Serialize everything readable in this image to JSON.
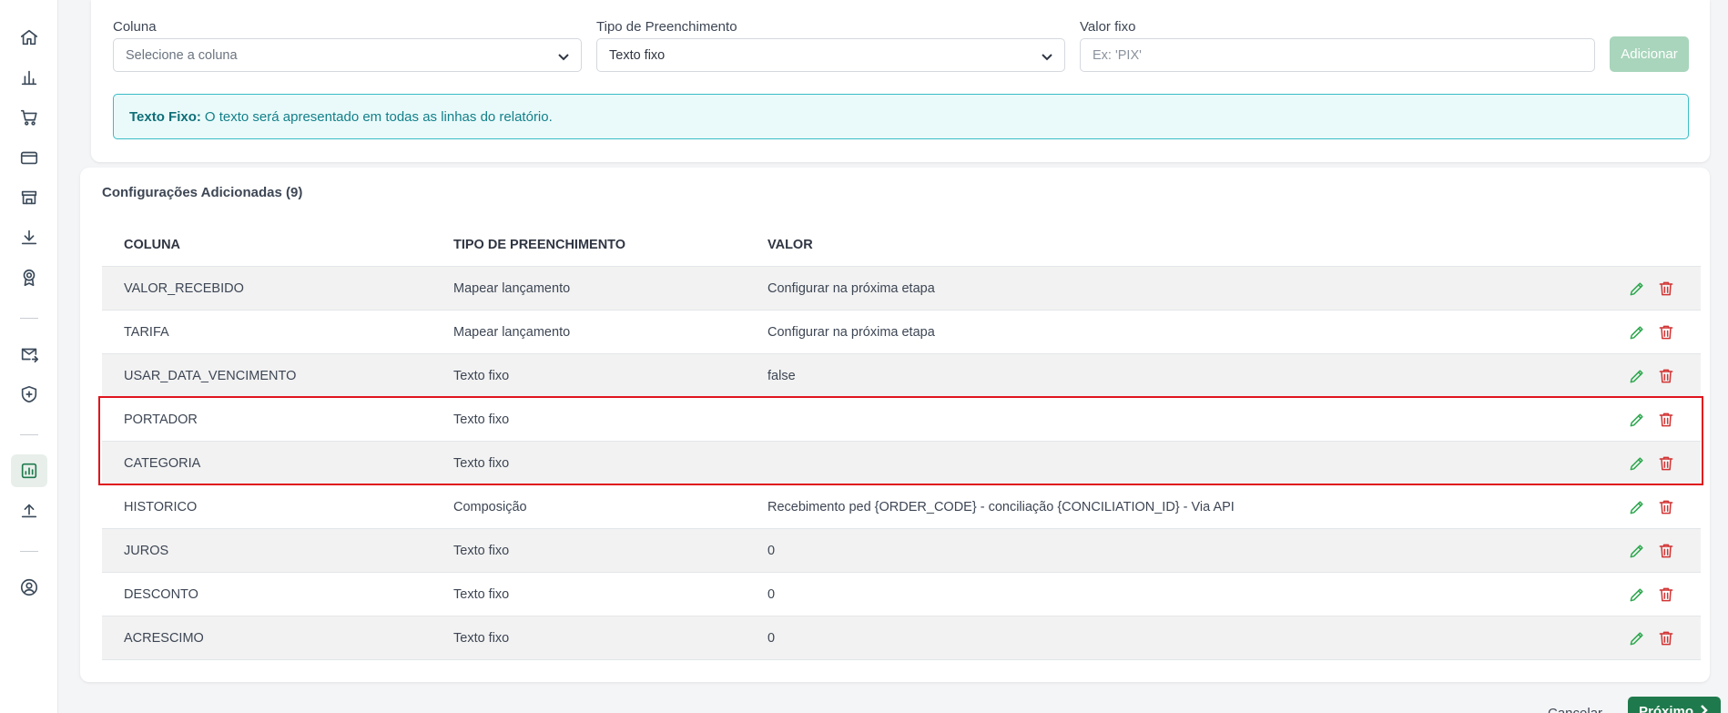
{
  "form": {
    "coluna_label": "Coluna",
    "coluna_placeholder": "Selecione a coluna",
    "tipo_label": "Tipo de Preenchimento",
    "tipo_value": "Texto fixo",
    "valor_label": "Valor fixo",
    "valor_placeholder": "Ex: 'PIX'",
    "add_label": "Adicionar"
  },
  "alert": {
    "title": "Texto Fixo:",
    "text": "O texto será apresentado em todas as linhas do relatório."
  },
  "section": {
    "title": "Configurações Adicionadas (9)"
  },
  "table": {
    "headers": [
      "COLUNA",
      "TIPO DE PREENCHIMENTO",
      "VALOR"
    ],
    "rows": [
      {
        "coluna": "VALOR_RECEBIDO",
        "tipo": "Mapear lançamento",
        "valor": "Configurar na próxima etapa"
      },
      {
        "coluna": "TARIFA",
        "tipo": "Mapear lançamento",
        "valor": "Configurar na próxima etapa"
      },
      {
        "coluna": "USAR_DATA_VENCIMENTO",
        "tipo": "Texto fixo",
        "valor": "false"
      },
      {
        "coluna": "PORTADOR",
        "tipo": "Texto fixo",
        "valor": ""
      },
      {
        "coluna": "CATEGORIA",
        "tipo": "Texto fixo",
        "valor": ""
      },
      {
        "coluna": "HISTORICO",
        "tipo": "Composição",
        "valor": "Recebimento ped {ORDER_CODE} - conciliação {CONCILIATION_ID} - Via API"
      },
      {
        "coluna": "JUROS",
        "tipo": "Texto fixo",
        "valor": "0"
      },
      {
        "coluna": "DESCONTO",
        "tipo": "Texto fixo",
        "valor": "0"
      },
      {
        "coluna": "ACRESCIMO",
        "tipo": "Texto fixo",
        "valor": "0"
      }
    ]
  },
  "footer": {
    "cancel_label": "Cancelar",
    "next_label": "Próximo"
  },
  "colors": {
    "accent": "#1e7a4c",
    "edit": "#2ea84f",
    "delete": "#d23434",
    "highlight": "#e0141e",
    "info": "#3bbcc6"
  },
  "sidebar": {
    "icons": [
      "home-icon",
      "bar-chart-icon",
      "cart-icon",
      "credit-card-icon",
      "store-icon",
      "download-icon",
      "award-icon",
      "mail-forward-icon",
      "shield-icon",
      "report-icon",
      "upload-icon",
      "user-circle-icon"
    ],
    "active": "report-icon"
  }
}
